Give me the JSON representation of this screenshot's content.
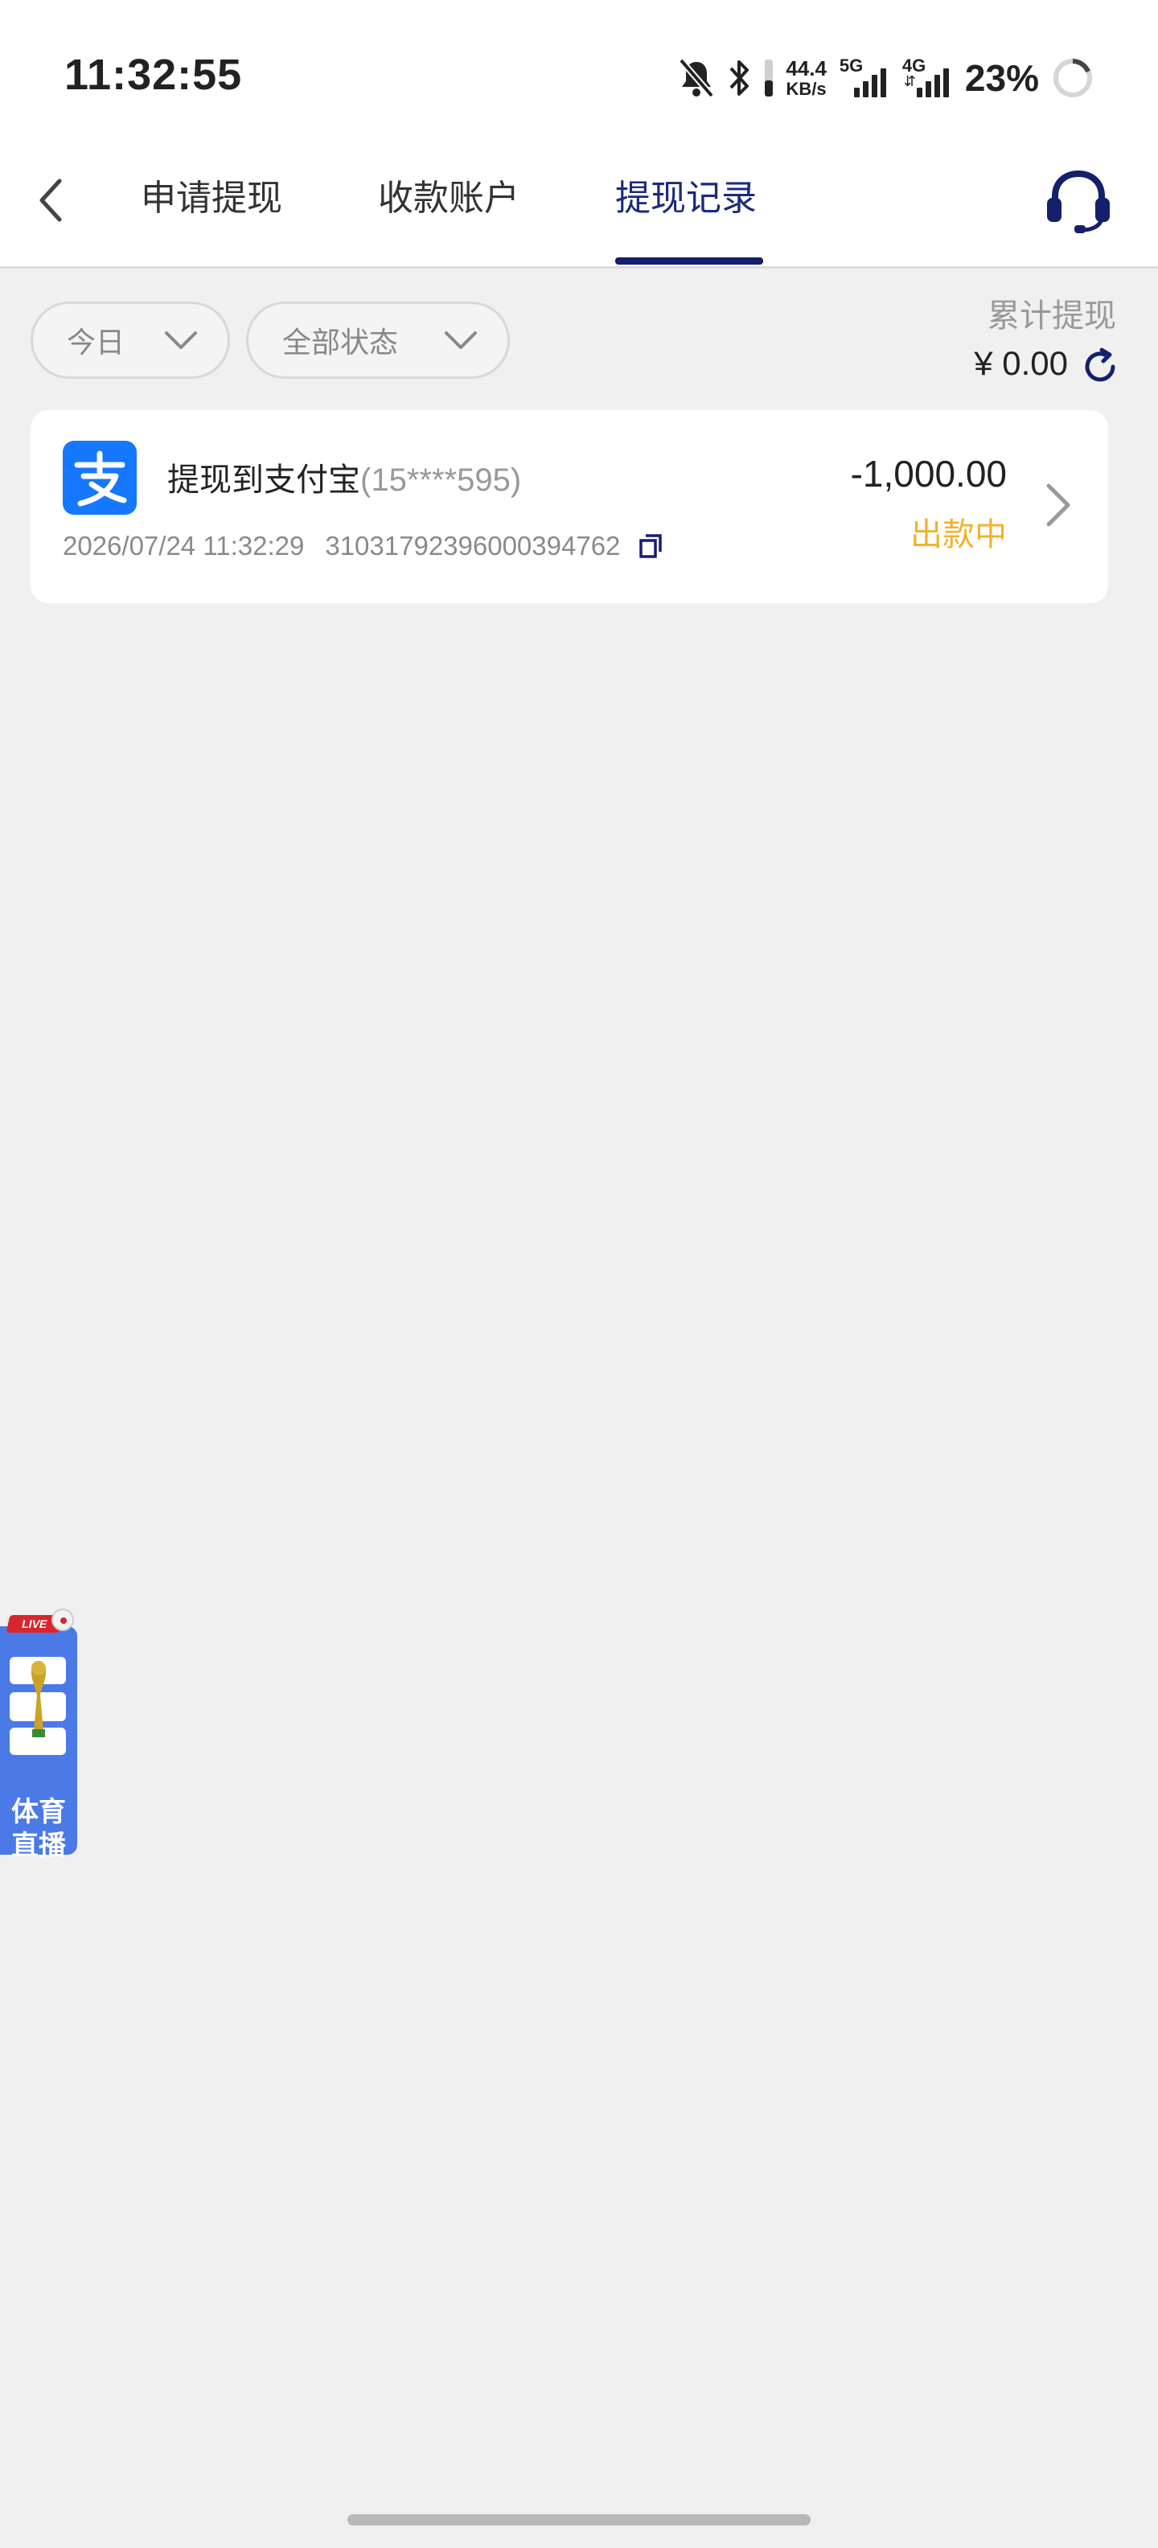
{
  "status_bar": {
    "time": "11:32:55",
    "net_speed_value": "44.4",
    "net_speed_unit": "KB/s",
    "signal_1_label": "5G",
    "signal_2_label": "4G",
    "battery_percent": "23%",
    "icons": [
      "mute-bell-icon",
      "bluetooth-icon",
      "signal-icon",
      "battery-icon"
    ]
  },
  "header": {
    "back_icon": "chevron-left-icon",
    "tabs": [
      {
        "label": "申请提现",
        "active": false
      },
      {
        "label": "收款账户",
        "active": false
      },
      {
        "label": "提现记录",
        "active": true
      }
    ],
    "support_icon": "headset-icon",
    "accent_color": "#14206b"
  },
  "filters": {
    "date_filter": "今日",
    "status_filter": "全部状态"
  },
  "summary": {
    "label": "累计提现",
    "amount": "¥ 0.00"
  },
  "records": [
    {
      "title": "提现到支付宝",
      "account": "(15****595)",
      "datetime": "2026/07/24 11:32:29",
      "order_no": "31031792396000394762",
      "amount": "-1,000.00",
      "status": "出款中",
      "status_color": "#f0b428",
      "logo_icon": "alipay-icon"
    }
  ],
  "live_float": {
    "tag": "LIVE",
    "line1": "体育",
    "line2": "直播"
  }
}
